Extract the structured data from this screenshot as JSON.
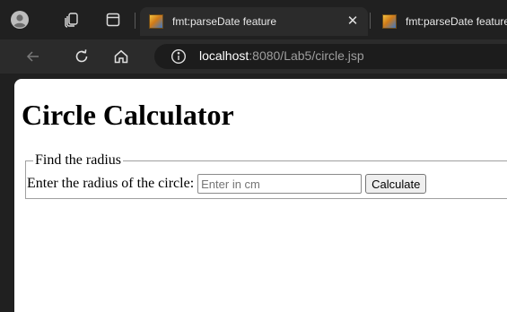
{
  "browser": {
    "tabs": [
      {
        "title": "fmt:parseDate feature",
        "active": true
      },
      {
        "title": "fmt:parseDate feature",
        "active": false
      }
    ],
    "address": {
      "host": "localhost",
      "rest": ":8080/Lab5/circle.jsp"
    },
    "icons": [
      "profile-avatar-icon",
      "workspaces-icon",
      "tab-actions-icon",
      "close-icon",
      "back-arrow-icon",
      "reload-icon",
      "home-icon",
      "site-info-icon"
    ]
  },
  "page": {
    "title": "Circle Calculator",
    "form": {
      "legend": "Find the radius",
      "label": "Enter the radius of the circle:",
      "input_value": "",
      "input_placeholder": "Enter in cm",
      "submit_label": "Calculate"
    }
  },
  "colors": {
    "chrome_bg": "#202020",
    "toolbar_bg": "#2b2b2b",
    "omnibox_bg": "#1c1c1c",
    "page_bg": "#ffffff"
  }
}
